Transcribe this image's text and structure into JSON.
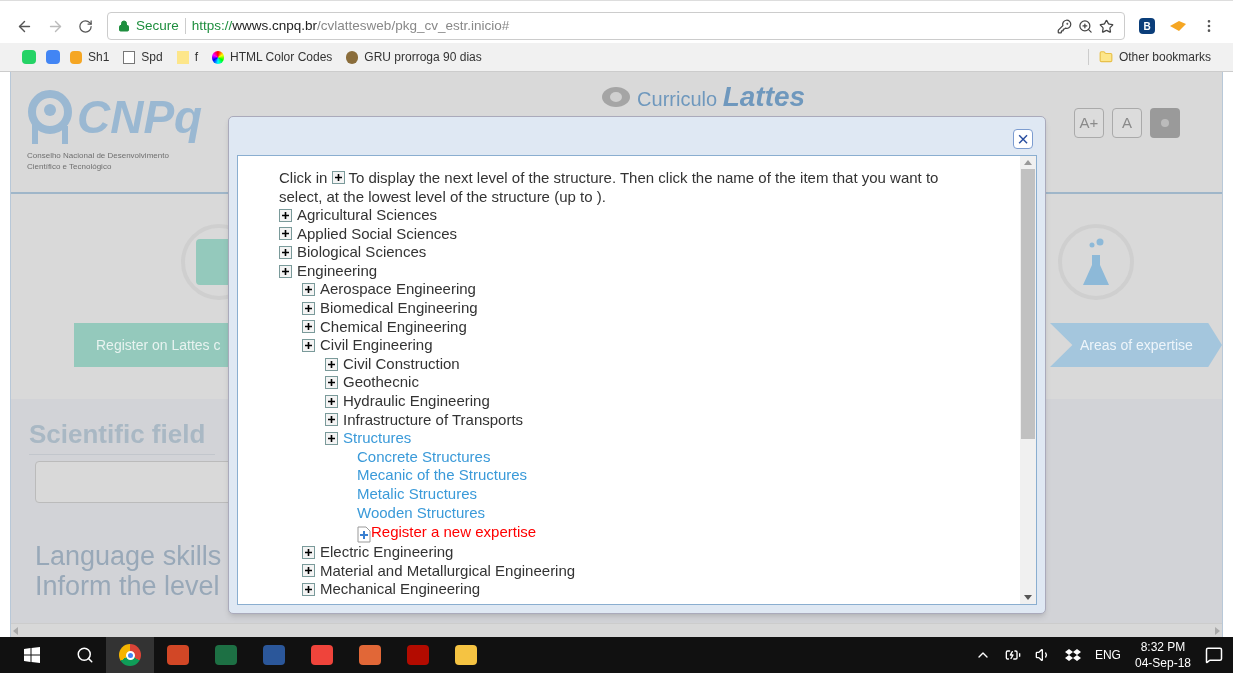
{
  "browser": {
    "secure_label": "Secure",
    "url_scheme": "https://",
    "url_host": "wwws.cnpq.br",
    "url_path": "/cvlattesweb/pkg_cv_estr.inicio#",
    "extension_letter": "B",
    "bookmarks": [
      {
        "label": "Sh1"
      },
      {
        "label": "Spd"
      },
      {
        "label": "f"
      },
      {
        "label": "HTML Color Codes"
      },
      {
        "label": "GRU prorroga 90 dias"
      }
    ],
    "other_bookmarks": "Other bookmarks"
  },
  "page": {
    "logo_text": "CNPq",
    "org_name": "Conselho Nacional de Desenvolvimento Científico e Tecnológico",
    "app_title_light": "Curriculo",
    "app_title_bold": "Lattes",
    "font_buttons": [
      "A+",
      "A"
    ],
    "steps": [
      {
        "label": "Register on Lattes c"
      },
      {
        "label": "Areas of expertise"
      }
    ],
    "section_title": "Scientific field",
    "language_title": "Language skills",
    "language_hint": "Inform the level"
  },
  "dialog": {
    "close_label": "×",
    "intro_before": "Click in",
    "intro_after": "To display the next level of the structure. Then click the name of the item that you want to select, at the lowest level of the structure (up to ).",
    "tree": [
      {
        "label": "Agricultural Sciences",
        "kind": "branch"
      },
      {
        "label": "Applied Social Sciences",
        "kind": "branch"
      },
      {
        "label": "Biological Sciences",
        "kind": "branch"
      },
      {
        "label": "Engineering",
        "kind": "branch",
        "children": [
          {
            "label": "Aerospace Engineering",
            "kind": "branch"
          },
          {
            "label": "Biomedical Engineering",
            "kind": "branch"
          },
          {
            "label": "Chemical Engineering",
            "kind": "branch"
          },
          {
            "label": "Civil Engineering",
            "kind": "branch",
            "children": [
              {
                "label": "Civil Construction",
                "kind": "branch"
              },
              {
                "label": "Geothecnic",
                "kind": "branch"
              },
              {
                "label": "Hydraulic Engineering",
                "kind": "branch"
              },
              {
                "label": "Infrastructure of Transports",
                "kind": "branch"
              },
              {
                "label": "Structures",
                "kind": "active-branch",
                "children": [
                  {
                    "label": "Concrete Structures",
                    "kind": "leaf"
                  },
                  {
                    "label": "Mecanic of the Structures",
                    "kind": "leaf"
                  },
                  {
                    "label": "Metalic Structures",
                    "kind": "leaf"
                  },
                  {
                    "label": "Wooden Structures",
                    "kind": "leaf"
                  },
                  {
                    "label": "Register a new expertise",
                    "kind": "add"
                  }
                ]
              }
            ]
          },
          {
            "label": "Electric Engineering",
            "kind": "branch"
          },
          {
            "label": "Material and Metallurgical Engineering",
            "kind": "branch"
          },
          {
            "label": "Mechanical Engineering",
            "kind": "branch"
          }
        ]
      }
    ]
  },
  "taskbar": {
    "language": "ENG",
    "time": "8:32 PM",
    "date": "04-Sep-18"
  }
}
